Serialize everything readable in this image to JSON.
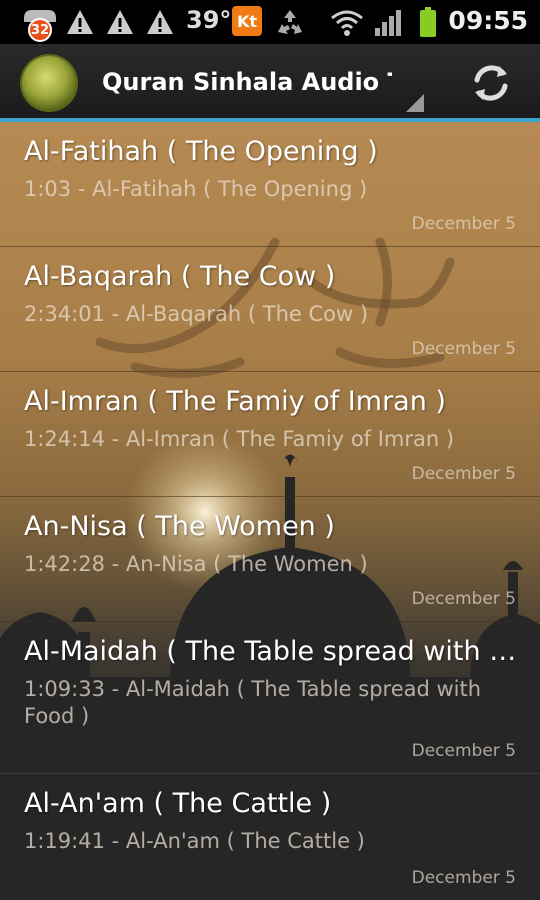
{
  "status_bar": {
    "notification_count": "32",
    "temperature": "39°",
    "carrier_icon_label": "Kt",
    "time": "09:55",
    "icons": [
      "notification-icon",
      "warning-icon",
      "warning-icon",
      "warning-icon",
      "recycle-icon",
      "wifi-icon",
      "signal-icon",
      "battery-icon"
    ]
  },
  "action_bar": {
    "title": "Quran Sinhala Audio Tracks",
    "logo_icon": "quran-logo-icon",
    "refresh_icon": "refresh-icon",
    "accent_color": "#3aa3d0"
  },
  "tracks": [
    {
      "title": "Al-Fatihah ( The Opening )",
      "subtitle": "1:03 - Al-Fatihah ( The Opening )",
      "date": "December 5"
    },
    {
      "title": "Al-Baqarah ( The Cow )",
      "subtitle": "2:34:01 - Al-Baqarah ( The Cow )",
      "date": "December 5"
    },
    {
      "title": "Al-Imran ( The Famiy of Imran )",
      "subtitle": "1:24:14 - Al-Imran ( The Famiy of Imran )",
      "date": "December 5"
    },
    {
      "title": "An-Nisa ( The Women )",
      "subtitle": "1:42:28 - An-Nisa ( The Women )",
      "date": "December 5"
    },
    {
      "title": "Al-Maidah ( The Table spread with Food )",
      "subtitle": "1:09:33 - Al-Maidah ( The Table spread with Food )",
      "date": "December 5"
    },
    {
      "title": "Al-An'am ( The Cattle )",
      "subtitle": "1:19:41 - Al-An'am ( The Cattle )",
      "date": "December 5"
    }
  ]
}
